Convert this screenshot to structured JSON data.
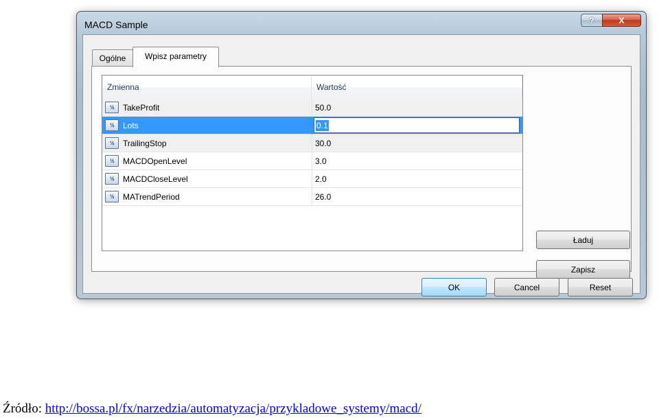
{
  "window": {
    "title": "MACD Sample",
    "help_label": "?",
    "close_label": "X"
  },
  "tabs": [
    {
      "label": "Ogólne"
    },
    {
      "label": "Wpisz parametry"
    }
  ],
  "list": {
    "columns": [
      "Zmienna",
      "Wartość"
    ],
    "icon_label": "½",
    "rows": [
      {
        "name": "TakeProfit",
        "value": "50.0"
      },
      {
        "name": "Lots",
        "value": "0.1"
      },
      {
        "name": "TrailingStop",
        "value": "30.0"
      },
      {
        "name": "MACDOpenLevel",
        "value": "3.0"
      },
      {
        "name": "MACDCloseLevel",
        "value": "2.0"
      },
      {
        "name": "MATrendPeriod",
        "value": "26.0"
      }
    ],
    "selected_index": 1
  },
  "buttons": {
    "laduj": "Ładuj",
    "zapisz": "Zapisz",
    "ok": "OK",
    "cancel": "Cancel",
    "reset": "Reset"
  },
  "source": {
    "label": "Źródło:",
    "url": "http://bossa.pl/fx/narzedzia/automatyzacja/przykladowe_systemy/macd/"
  }
}
